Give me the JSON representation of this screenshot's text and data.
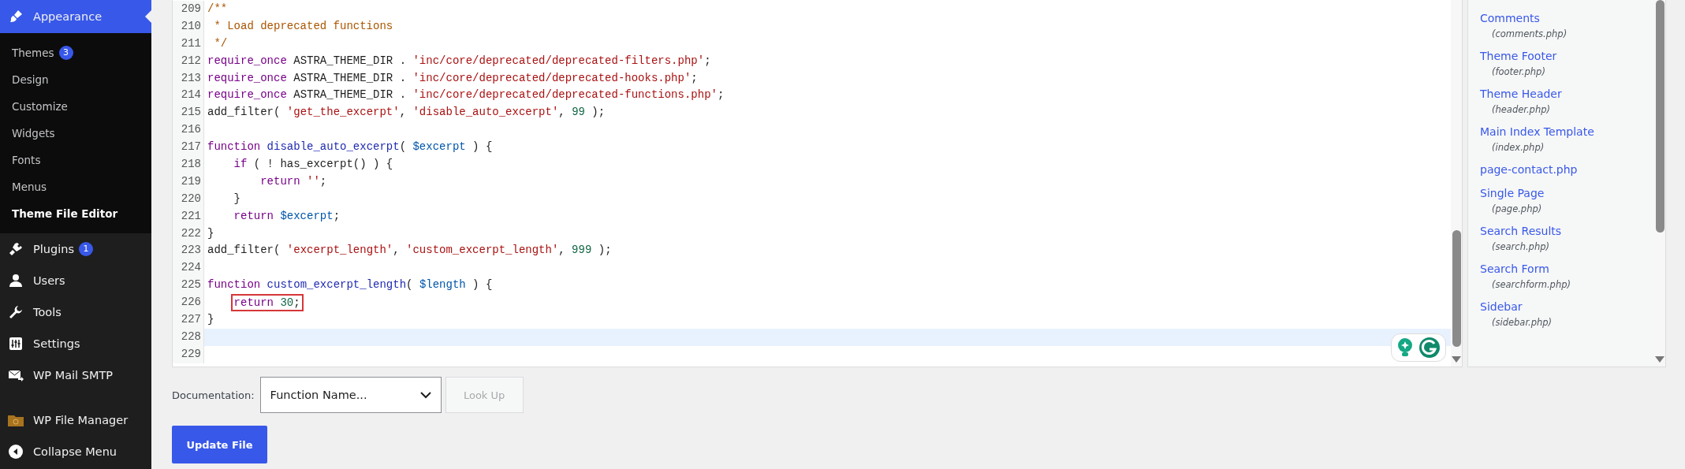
{
  "sidebar": {
    "items": [
      {
        "label": "Appearance",
        "kind": "brush",
        "selected": true,
        "children": [
          {
            "label": "Themes",
            "count": "3",
            "selected": false
          },
          {
            "label": "Design",
            "selected": false
          },
          {
            "label": "Customize",
            "selected": false
          },
          {
            "label": "Widgets",
            "selected": false
          },
          {
            "label": "Fonts",
            "selected": false
          },
          {
            "label": "Menus",
            "selected": false
          },
          {
            "label": "Theme File Editor",
            "selected": true
          }
        ]
      },
      {
        "label": "Plugins",
        "kind": "plug",
        "count": "1",
        "selected": false
      },
      {
        "label": "Users",
        "kind": "user",
        "selected": false
      },
      {
        "label": "Tools",
        "kind": "wrench",
        "selected": false
      },
      {
        "label": "Settings",
        "kind": "sliders",
        "selected": false
      },
      {
        "label": "WP Mail SMTP",
        "kind": "mail",
        "selected": false
      },
      {
        "label": "WP File Manager",
        "kind": "folder",
        "selected": false
      },
      {
        "label": "Collapse Menu",
        "kind": "collapse",
        "selected": false
      }
    ]
  },
  "editor": {
    "lines": [
      {
        "number": "209",
        "active": false,
        "boxed": false,
        "tokens": [
          {
            "kind": "comment",
            "text": "/**"
          }
        ]
      },
      {
        "number": "210",
        "active": false,
        "boxed": false,
        "tokens": [
          {
            "kind": "comment",
            "text": " * Load deprecated functions"
          }
        ]
      },
      {
        "number": "211",
        "active": false,
        "boxed": false,
        "tokens": [
          {
            "kind": "comment",
            "text": " */"
          }
        ]
      },
      {
        "number": "212",
        "active": false,
        "boxed": false,
        "tokens": [
          {
            "kind": "keyword",
            "text": "require_once"
          },
          {
            "kind": "plain",
            "text": " ASTRA_THEME_DIR . "
          },
          {
            "kind": "string",
            "text": "'inc/core/deprecated/deprecated-filters.php'"
          },
          {
            "kind": "plain",
            "text": ";"
          }
        ]
      },
      {
        "number": "213",
        "active": false,
        "boxed": false,
        "tokens": [
          {
            "kind": "keyword",
            "text": "require_once"
          },
          {
            "kind": "plain",
            "text": " ASTRA_THEME_DIR . "
          },
          {
            "kind": "string",
            "text": "'inc/core/deprecated/deprecated-hooks.php'"
          },
          {
            "kind": "plain",
            "text": ";"
          }
        ]
      },
      {
        "number": "214",
        "active": false,
        "boxed": false,
        "tokens": [
          {
            "kind": "keyword",
            "text": "require_once"
          },
          {
            "kind": "plain",
            "text": " ASTRA_THEME_DIR . "
          },
          {
            "kind": "string",
            "text": "'inc/core/deprecated/deprecated-functions.php'"
          },
          {
            "kind": "plain",
            "text": ";"
          }
        ]
      },
      {
        "number": "215",
        "active": false,
        "boxed": false,
        "tokens": [
          {
            "kind": "plain",
            "text": "add_filter( "
          },
          {
            "kind": "string",
            "text": "'get_the_excerpt'"
          },
          {
            "kind": "plain",
            "text": ", "
          },
          {
            "kind": "string",
            "text": "'disable_auto_excerpt'"
          },
          {
            "kind": "plain",
            "text": ", "
          },
          {
            "kind": "number",
            "text": "99"
          },
          {
            "kind": "plain",
            "text": " );"
          }
        ]
      },
      {
        "number": "216",
        "active": false,
        "boxed": false
      },
      {
        "number": "217",
        "active": false,
        "boxed": false,
        "tokens": [
          {
            "kind": "keyword",
            "text": "function"
          },
          {
            "kind": "def",
            "text": " disable_auto_excerpt"
          },
          {
            "kind": "plain",
            "text": "( "
          },
          {
            "kind": "variable",
            "text": "$excerpt"
          },
          {
            "kind": "plain",
            "text": " ) {"
          }
        ]
      },
      {
        "number": "218",
        "active": false,
        "boxed": false,
        "tokens": [
          {
            "kind": "keyword",
            "text": "    if"
          },
          {
            "kind": "plain",
            "text": " ( ! has_excerpt() ) {"
          }
        ]
      },
      {
        "number": "219",
        "active": false,
        "boxed": false,
        "tokens": [
          {
            "kind": "keyword",
            "text": "        return"
          },
          {
            "kind": "string",
            "text": " ''"
          },
          {
            "kind": "plain",
            "text": ";"
          }
        ]
      },
      {
        "number": "220",
        "active": false,
        "boxed": false,
        "tokens": [
          {
            "kind": "plain",
            "text": "    }"
          }
        ]
      },
      {
        "number": "221",
        "active": false,
        "boxed": false,
        "tokens": [
          {
            "kind": "keyword",
            "text": "    return"
          },
          {
            "kind": "variable",
            "text": " $excerpt"
          },
          {
            "kind": "plain",
            "text": ";"
          }
        ]
      },
      {
        "number": "222",
        "active": false,
        "boxed": false,
        "tokens": [
          {
            "kind": "plain",
            "text": "}"
          }
        ]
      },
      {
        "number": "223",
        "active": false,
        "boxed": false,
        "tokens": [
          {
            "kind": "plain",
            "text": "add_filter( "
          },
          {
            "kind": "string",
            "text": "'excerpt_length'"
          },
          {
            "kind": "plain",
            "text": ", "
          },
          {
            "kind": "string",
            "text": "'custom_excerpt_length'"
          },
          {
            "kind": "plain",
            "text": ", "
          },
          {
            "kind": "number",
            "text": "999"
          },
          {
            "kind": "plain",
            "text": " );"
          }
        ]
      },
      {
        "number": "224",
        "active": false,
        "boxed": false
      },
      {
        "number": "225",
        "active": false,
        "boxed": false,
        "tokens": [
          {
            "kind": "keyword",
            "text": "function"
          },
          {
            "kind": "def",
            "text": " custom_excerpt_length"
          },
          {
            "kind": "plain",
            "text": "( "
          },
          {
            "kind": "variable",
            "text": "$length"
          },
          {
            "kind": "plain",
            "text": " ) {"
          }
        ]
      },
      {
        "number": "226",
        "active": false,
        "boxed": true,
        "tokens": [
          {
            "kind": "keyword",
            "text": "    return"
          },
          {
            "kind": "number",
            "text": " 30"
          },
          {
            "kind": "plain",
            "text": ";"
          }
        ]
      },
      {
        "number": "227",
        "active": false,
        "boxed": false,
        "tokens": [
          {
            "kind": "plain",
            "text": "}"
          }
        ]
      },
      {
        "number": "228",
        "active": true,
        "boxed": false
      },
      {
        "number": "229",
        "active": false,
        "boxed": false
      }
    ]
  },
  "files": [
    {
      "name": "Comments",
      "file": "(comments.php)"
    },
    {
      "name": "Theme Footer",
      "file": "(footer.php)"
    },
    {
      "name": "Theme Header",
      "file": "(header.php)"
    },
    {
      "name": "Main Index Template",
      "file": "(index.php)"
    },
    {
      "name": "page-contact.php"
    },
    {
      "name": "Single Page",
      "file": "(page.php)"
    },
    {
      "name": "Search Results",
      "file": "(search.php)"
    },
    {
      "name": "Search Form",
      "file": "(searchform.php)"
    },
    {
      "name": "Sidebar",
      "file": "(sidebar.php)"
    }
  ],
  "documentation": {
    "label": "Documentation:",
    "select": "Function Name...",
    "button": "Look Up",
    "button_disabled": true
  },
  "update_button": "Update File"
}
